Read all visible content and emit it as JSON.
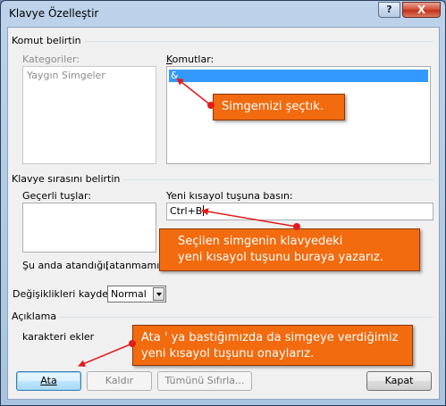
{
  "window": {
    "title": "Klavye Özelleştir",
    "help_label": "?",
    "close_label": "X"
  },
  "commands_section": {
    "group_label": "Komut belirtin",
    "categories_label": "Kategoriler:",
    "categories": [
      "Yaygın Simgeler"
    ],
    "commands_label": "Komutlar:",
    "commands": [
      "&"
    ]
  },
  "keyboard_section": {
    "group_label": "Klavye sırasını belirtin",
    "current_keys_label": "Geçerli tuşlar:",
    "new_shortcut_label": "Yeni kısayol tuşuna basın:",
    "new_shortcut_value": "Ctrl+B",
    "assigned_label": "Şu anda atandığı:",
    "assigned_value": "[atanmamış]"
  },
  "save_section": {
    "label": "Değişiklikleri kaydet:",
    "selected_value": "Normal"
  },
  "description_section": {
    "group_label": "Açıklama",
    "text": "karakteri ekler"
  },
  "buttons": {
    "assign": "Ata",
    "remove": "Kaldır",
    "reset_all": "Tümünü Sıfırla...",
    "close": "Kapat"
  },
  "callouts": {
    "symbol_selected": "Simgemizi şeçtık.",
    "shortcut_line1": "Seçilen simgenin klavyedeki",
    "shortcut_line2": "yeni kısayol tuşunu buraya yazarız.",
    "assign_line1": "Ata ' ya bastığımızda da simgeye verdiğimiz",
    "assign_line2": "yeni kısayol tuşunu onaylarız."
  },
  "colors": {
    "callout_fill": "#f26b0f",
    "arrow_red": "#e21b1b",
    "selection_blue": "#3399ff"
  }
}
